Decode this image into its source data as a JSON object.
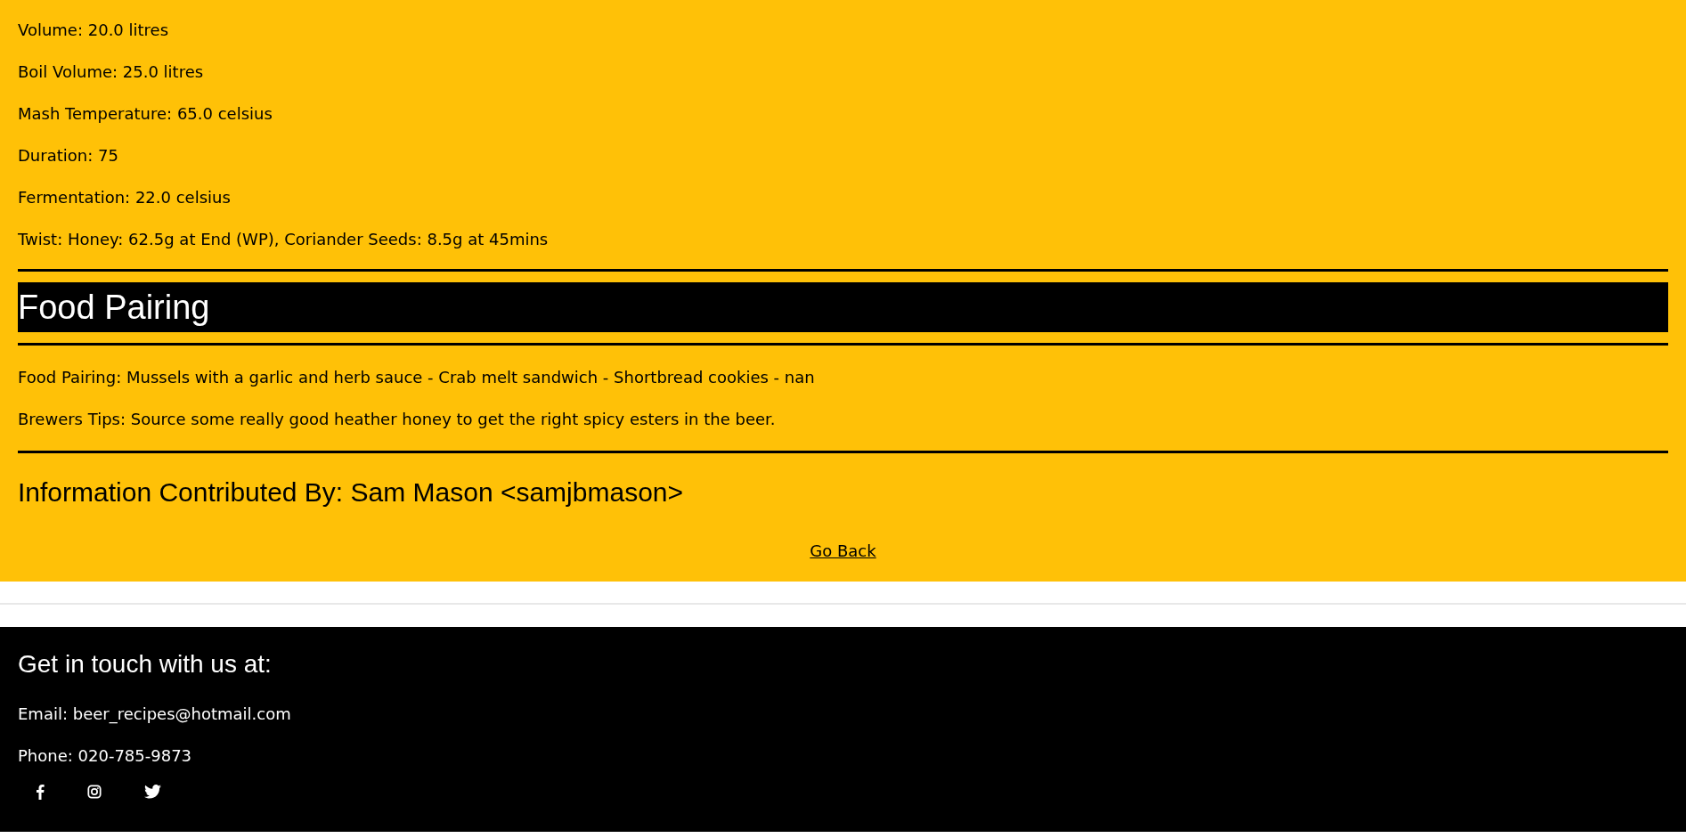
{
  "details": [
    "Volume: 20.0 litres",
    "Boil Volume: 25.0 litres",
    "Mash Temperature: 65.0 celsius",
    "Duration: 75",
    "Fermentation: 22.0 celsius",
    "Twist: Honey: 62.5g at End (WP), Coriander Seeds: 8.5g at 45mins"
  ],
  "food_heading": "Food Pairing",
  "food_lines": [
    "Food Pairing: Mussels with a garlic and herb sauce - Crab melt sandwich - Shortbread cookies - nan",
    "Brewers Tips: Source some really good heather honey to get the right spicy esters in the beer."
  ],
  "contributor": "Information Contributed By: Sam Mason <samjbmason>",
  "back_link": "Go Back",
  "footer": {
    "heading": "Get in touch with us at:",
    "email": "Email: beer_recipes@hotmail.com",
    "phone": "Phone: 020-785-9873",
    "social": [
      {
        "kind": "facebook"
      },
      {
        "kind": "instagram"
      },
      {
        "kind": "twitter"
      }
    ]
  }
}
